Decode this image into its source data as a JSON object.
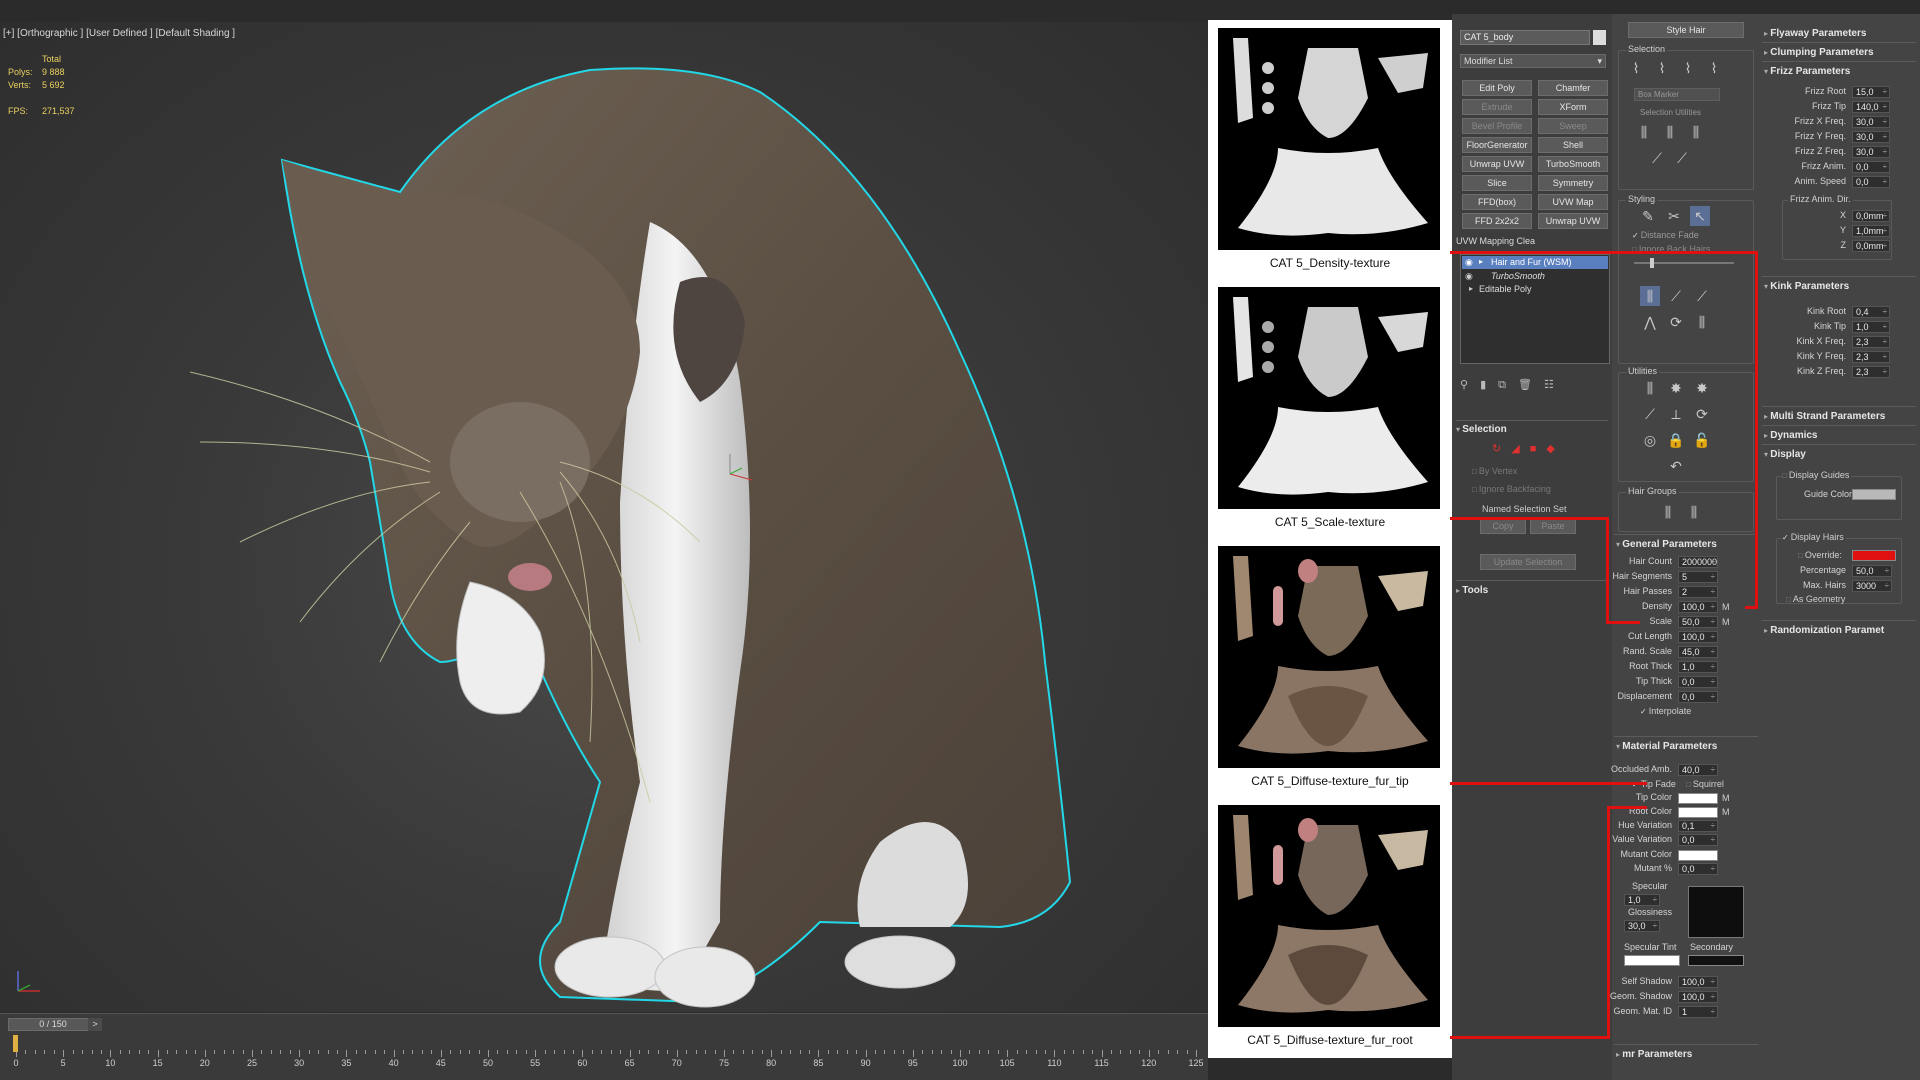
{
  "viewport": {
    "label": "[+] [Orthographic ] [User Defined ] [Default Shading ]",
    "stats": {
      "total_label": "Total",
      "polys_label": "Polys:",
      "polys_value": "9 888",
      "verts_label": "Verts:",
      "verts_value": "5 692",
      "fps_label": "FPS:",
      "fps_value": "271,537"
    }
  },
  "timeline": {
    "frame_display": "0 / 150",
    "next_label": ">",
    "ticks": [
      "0",
      "5",
      "10",
      "15",
      "20",
      "25",
      "30",
      "35",
      "40",
      "45",
      "50",
      "55",
      "60",
      "65",
      "70",
      "75",
      "80",
      "85",
      "90",
      "95",
      "100",
      "105",
      "110",
      "115",
      "120",
      "125"
    ]
  },
  "textures": [
    {
      "caption": "CAT 5_Density-texture"
    },
    {
      "caption": "CAT 5_Scale-texture"
    },
    {
      "caption": "CAT 5_Diffuse-texture_fur_tip"
    },
    {
      "caption": "CAT 5_Diffuse-texture_fur_root"
    }
  ],
  "modify_panel": {
    "object_name": "CAT 5_body",
    "modifier_list_label": "Modifier List",
    "buttons": [
      {
        "label": "Edit Poly",
        "enabled": true
      },
      {
        "label": "Chamfer",
        "enabled": true
      },
      {
        "label": "Extrude",
        "enabled": false
      },
      {
        "label": "XForm",
        "enabled": true
      },
      {
        "label": "Bevel Profile",
        "enabled": false
      },
      {
        "label": "Sweep",
        "enabled": false
      },
      {
        "label": "FloorGenerator",
        "enabled": true
      },
      {
        "label": "Shell",
        "enabled": true
      },
      {
        "label": "Unwrap UVW",
        "enabled": true
      },
      {
        "label": "TurboSmooth",
        "enabled": true
      },
      {
        "label": "Slice",
        "enabled": true
      },
      {
        "label": "Symmetry",
        "enabled": true
      },
      {
        "label": "FFD(box)",
        "enabled": true
      },
      {
        "label": "UVW Map",
        "enabled": true
      },
      {
        "label": "FFD 2x2x2",
        "enabled": true
      },
      {
        "label": "Unwrap UVW",
        "enabled": true
      }
    ],
    "uvw_mapping_clear": "UVW Mapping Clea",
    "stack": [
      "Hair and Fur (WSM)",
      "TurboSmooth",
      "Editable Poly"
    ],
    "selection_header": "Selection",
    "by_vertex": "By Vertex",
    "ignore_backfacing": "Ignore Backfacing",
    "named_selection_set": "Named Selection Set",
    "copy_label": "Copy",
    "paste_label": "Paste",
    "update_selection": "Update Selection",
    "tools_header": "Tools"
  },
  "styling_panel": {
    "style_hair": "Style Hair",
    "selection_label": "Selection",
    "box_marker": "Box Marker",
    "selection_utilities": "Selection Utilities",
    "styling_label": "Styling",
    "distance_fade": "Distance Fade",
    "ignore_back_hairs": "Ignore Back Hairs",
    "utilities_label": "Utilities",
    "hair_groups_label": "Hair Groups",
    "general_parameters": {
      "header": "General Parameters",
      "rows": [
        {
          "label": "Hair Count",
          "value": "2000000"
        },
        {
          "label": "Hair Segments",
          "value": "5"
        },
        {
          "label": "Hair Passes",
          "value": "2"
        },
        {
          "label": "Density",
          "value": "100,0",
          "map": "M"
        },
        {
          "label": "Scale",
          "value": "50,0",
          "map": "M"
        },
        {
          "label": "Cut Length",
          "value": "100,0"
        },
        {
          "label": "Rand. Scale",
          "value": "45,0"
        },
        {
          "label": "Root Thick",
          "value": "1,0"
        },
        {
          "label": "Tip Thick",
          "value": "0,0"
        },
        {
          "label": "Displacement",
          "value": "0,0"
        }
      ],
      "interpolate": "Interpolate"
    },
    "material_parameters": {
      "header": "Material Parameters",
      "occluded_amb_label": "Occluded Amb.",
      "occluded_amb_value": "40,0",
      "tip_fade": "Tip Fade",
      "squirrel": "Squirrel",
      "tip_color_label": "Tip Color",
      "root_color_label": "Root Color",
      "map_label": "M",
      "hue_variation_label": "Hue Variation",
      "hue_variation_value": "0,1",
      "value_variation_label": "Value Variation",
      "value_variation_value": "0,0",
      "mutant_color_label": "Mutant Color",
      "mutant_pct_label": "Mutant %",
      "mutant_pct_value": "0,0",
      "specular_label": "Specular",
      "specular_value": "1,0",
      "glossiness_label": "Glossiness",
      "glossiness_value": "30,0",
      "specular_tint_label": "Specular Tint",
      "secondary_label": "Secondary",
      "self_shadow_label": "Self Shadow",
      "self_shadow_value": "100,0",
      "geom_shadow_label": "Geom. Shadow",
      "geom_shadow_value": "100,0",
      "geom_mat_id_label": "Geom. Mat. ID",
      "geom_mat_id_value": "1"
    },
    "mr_parameters": "mr Parameters"
  },
  "params_panel": {
    "flyaway": "Flyaway Parameters",
    "clumping": "Clumping Parameters",
    "frizz": {
      "header": "Frizz Parameters",
      "rows": [
        {
          "label": "Frizz Root",
          "value": "15,0"
        },
        {
          "label": "Frizz Tip",
          "value": "140,0"
        },
        {
          "label": "Frizz X Freq.",
          "value": "30,0"
        },
        {
          "label": "Frizz Y Freq.",
          "value": "30,0"
        },
        {
          "label": "Frizz Z Freq.",
          "value": "30,0"
        },
        {
          "label": "Frizz Anim.",
          "value": "0,0"
        },
        {
          "label": "Anim. Speed",
          "value": "0,0"
        }
      ],
      "anim_dir_label": "Frizz Anim. Dir.",
      "dir_rows": [
        {
          "label": "X",
          "value": "0,0mm"
        },
        {
          "label": "Y",
          "value": "1,0mm"
        },
        {
          "label": "Z",
          "value": "0,0mm"
        }
      ]
    },
    "kink": {
      "header": "Kink Parameters",
      "rows": [
        {
          "label": "Kink Root",
          "value": "0,4"
        },
        {
          "label": "Kink Tip",
          "value": "1,0"
        },
        {
          "label": "Kink X Freq.",
          "value": "2,3"
        },
        {
          "label": "Kink Y Freq.",
          "value": "2,3"
        },
        {
          "label": "Kink Z Freq.",
          "value": "2,3"
        }
      ]
    },
    "multi_strand": "Multi Strand Parameters",
    "dynamics": "Dynamics",
    "display": {
      "header": "Display",
      "display_guides": "Display Guides",
      "guide_color_label": "Guide Color",
      "display_hairs": "Display Hairs",
      "override_label": "Override:",
      "percentage_label": "Percentage",
      "percentage_value": "50,0",
      "max_hairs_label": "Max. Hairs",
      "max_hairs_value": "3000",
      "as_geometry": "As Geometry"
    },
    "randomization": "Randomization Paramet"
  },
  "colors": {
    "selection_outline": "#22d8e8",
    "annotation_red": "#e01010",
    "override_color": "#e01010",
    "guide_color": "#b8b8b8"
  }
}
